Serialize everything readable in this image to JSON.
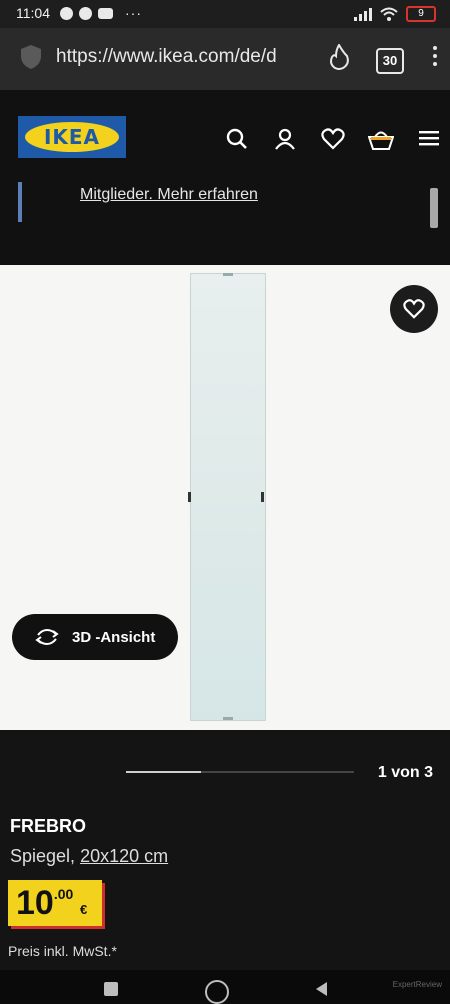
{
  "status_bar": {
    "time": "11:04",
    "more": "···",
    "battery": "9"
  },
  "browser": {
    "url": "https://www.ikea.com/de/d",
    "tab_count": "30"
  },
  "site_header": {
    "logo_text": "IKEA",
    "promo_link": "Mitglieder. Mehr erfahren"
  },
  "product_view": {
    "view_3d_label": "3D -Ansicht"
  },
  "details": {
    "pager": "1 von 3",
    "pager_progress": 0.33,
    "name": "FREBRO",
    "desc_type": "Spiegel, ",
    "desc_size": "20x120 cm",
    "price_int": "10",
    "price_dec": ".00",
    "currency": "€",
    "vat_note": "Preis inkl. MwSt.*"
  },
  "watermark": "ExpertReview",
  "colors": {
    "ikea_blue": "#1f5aa8",
    "ikea_yellow": "#f2d21c",
    "price_shadow": "#cf2e2e"
  },
  "icons": [
    "shield-icon",
    "flame-icon",
    "search-icon",
    "user-icon",
    "heart-icon",
    "basket-icon",
    "menu-icon",
    "rotate-icon"
  ]
}
